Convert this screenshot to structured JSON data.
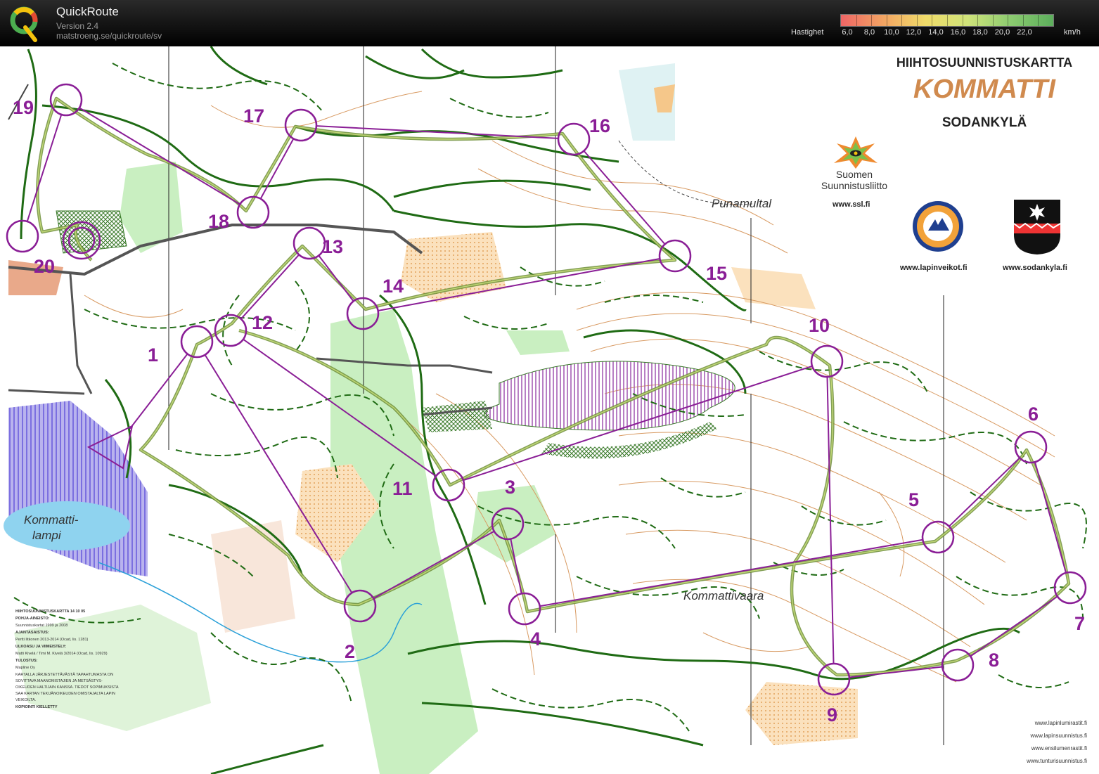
{
  "app": {
    "name": "QuickRoute",
    "version": "Version 2.4",
    "url": "matstroeng.se/quickroute/sv",
    "logo_icon": "quickroute-q-logo"
  },
  "speed_legend": {
    "label": "Hastighet",
    "unit": "km/h",
    "ticks": [
      "6,0",
      "8,0",
      "10,0",
      "12,0",
      "14,0",
      "16,0",
      "18,0",
      "20,0",
      "22,0"
    ],
    "gradient_colors": [
      "#ee6666",
      "#f2a463",
      "#f0dc6a",
      "#cfe37a",
      "#8ccb70",
      "#5cae5c"
    ]
  },
  "map": {
    "title_line1": "HIIHTOSUUNNISTUSKARTTA",
    "title_line2": "KOMMATTI",
    "title_line3": "SODANKYLÄ",
    "ssl_name": "Suomen Suunnistusliitto",
    "ssl_url": "www.ssl.fi",
    "lapinveikot_url": "www.lapinveikot.fi",
    "sodankyla_url": "www.sodankyla.fi",
    "places": {
      "punamultal": "Punamultal",
      "kommattilampi_1": "Kommatti-",
      "kommattilampi_2": "lampi",
      "kommattivaara": "Kommattivaara"
    },
    "metadata": [
      "HIIHTOSUUNNISTUSKARTTA   14 10 05",
      "POHJA-AINEISTO:",
      "Suunnistuskartat 1999 ja 2008",
      "AJANTASAISTUS:",
      "Pertti Iitkonen 2013-2014 (Ocad, lis. 1281)",
      "ULKOASU JA VIIMEISTELY:",
      "Matti Kivelä / Timi M. Kivelä 3/2014 (Ocad, lis. 10929)",
      "TULOSTUS:",
      "Mapline Oy",
      "KARTALLA JÄRJESTETTÄVÄSTÄ TAPAHTUMASTA ON SOVITTAVA MAANOMISTAJIEN JA METSÄSTYS- OIKEUDEN HALTIJAIN KANSSA. TIEDOT SOPIMUKSISTA SAA KARTAN TEKIJÄNOIKEUDEN OMISTAJALTA LAPIN VEIKOILTA.",
      "KOPIOINTI KIELLETTY"
    ],
    "sponsors": [
      "www.lapinlumirastit.fi",
      "www.lapinsuunnistus.fi",
      "www.ensilumenrastit.fi",
      "www.tunturisuunnistus.fi"
    ],
    "course_color": "#8a1e96",
    "controls": [
      {
        "label": "1"
      },
      {
        "label": "2"
      },
      {
        "label": "3"
      },
      {
        "label": "4"
      },
      {
        "label": "5"
      },
      {
        "label": "6"
      },
      {
        "label": "7"
      },
      {
        "label": "8"
      },
      {
        "label": "9"
      },
      {
        "label": "10"
      },
      {
        "label": "11"
      },
      {
        "label": "12"
      },
      {
        "label": "13"
      },
      {
        "label": "14"
      },
      {
        "label": "15"
      },
      {
        "label": "16"
      },
      {
        "label": "17"
      },
      {
        "label": "18"
      },
      {
        "label": "19"
      },
      {
        "label": "20"
      }
    ]
  }
}
